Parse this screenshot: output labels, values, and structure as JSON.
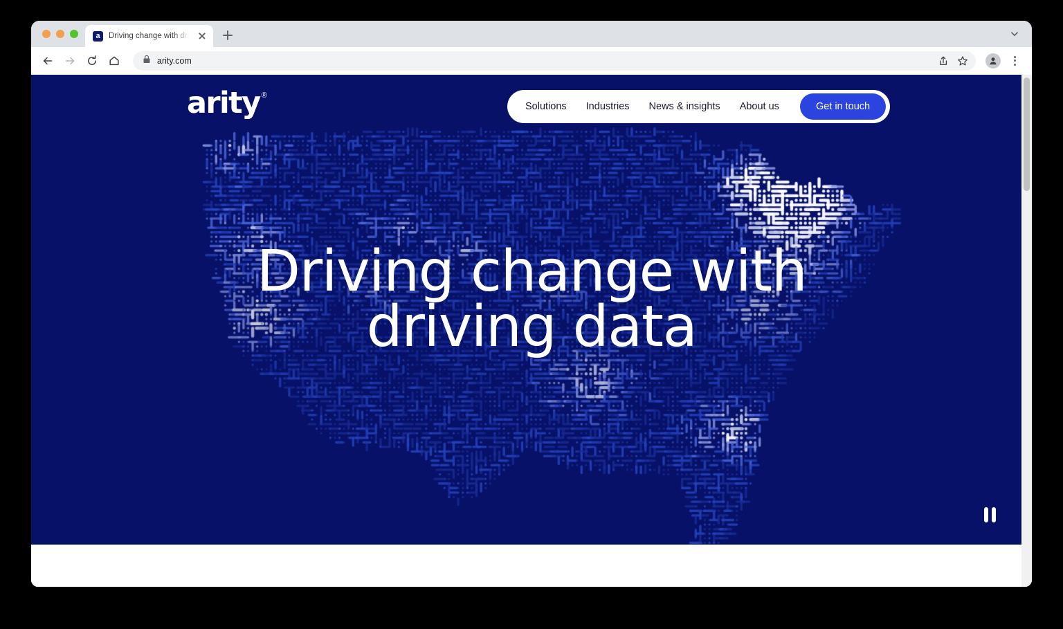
{
  "browser": {
    "traffic_lights": [
      "close",
      "minimize",
      "maximize"
    ],
    "tab": {
      "favicon_letter": "a",
      "title": "Driving change with driving da",
      "close_icon": "close-icon"
    },
    "new_tab_label": "+",
    "tab_list_icon": "chevron-down-icon",
    "toolbar": {
      "back_icon": "back-arrow-icon",
      "forward_icon": "forward-arrow-icon",
      "reload_icon": "reload-icon",
      "home_icon": "home-icon",
      "lock_icon": "lock-icon",
      "url": "arity.com",
      "share_icon": "share-icon",
      "bookmark_icon": "star-icon",
      "profile_icon": "profile-avatar-icon",
      "menu_icon": "three-dot-menu-icon"
    }
  },
  "site": {
    "logo": {
      "text": "arity",
      "trademark": "®"
    },
    "nav": {
      "links": [
        {
          "label": "Solutions"
        },
        {
          "label": "Industries"
        },
        {
          "label": "News & insights"
        },
        {
          "label": "About us"
        }
      ],
      "cta_label": "Get in touch"
    },
    "hero": {
      "headline_line1": "Driving change with",
      "headline_line2": "driving data",
      "pause_icon": "pause-icon",
      "background_color": "#061167",
      "accent_color": "#2b44e0",
      "dot_colors": [
        "#1b2f9c",
        "#2847c4",
        "#4f6ae0",
        "#8d9ae8",
        "#ccd2f2",
        "#ffffff"
      ],
      "background_description": "dot-matrix map of the United States"
    }
  }
}
